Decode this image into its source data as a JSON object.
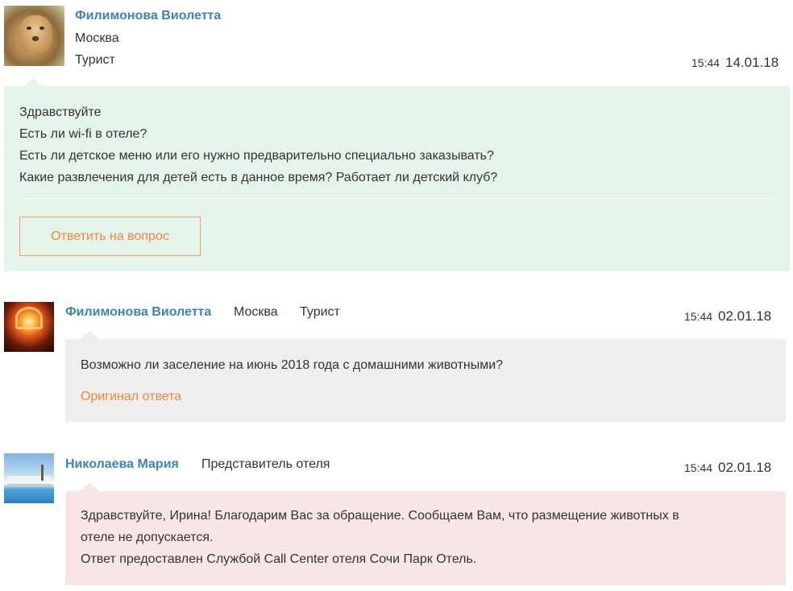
{
  "messages": [
    {
      "author": "Филимонова Виолетта",
      "city": "Москва",
      "role": "Турист",
      "time": "15:44",
      "date": "14.01.18",
      "lines": [
        "Здравствуйте",
        "Есть ли wi-fi в отеле?",
        "Есть ли детское меню или его нужно предварительно специально заказывать?",
        "Какие развлечения для детей есть в данное время? Работает ли детский клуб?"
      ],
      "reply_button": "Ответить на вопрос"
    },
    {
      "author": "Филимонова Виолетта",
      "city": "Москва",
      "role": "Турист",
      "time": "15:44",
      "date": "02.01.18",
      "lines": [
        "Возможно ли заселение на июнь 2018 года с домашними животными?"
      ],
      "original_link": "Оригинал ответа"
    },
    {
      "author": "Николаева Мария",
      "role": "Представитель отеля",
      "time": "15:44",
      "date": "02.01.18",
      "lines": [
        "Здравствуйте, Ирина! Благодарим Вас за обращение. Сообщаем Вам, что размещение животных в",
        "отеле не допускается.",
        "Ответ предоставлен Службой Call Center отеля Сочи Парк Отель."
      ]
    }
  ]
}
